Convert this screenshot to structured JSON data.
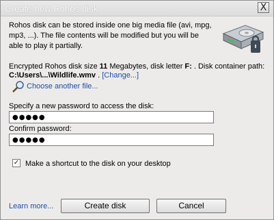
{
  "window": {
    "title": "Create new Rohos disk",
    "close_glyph": "X"
  },
  "intro": {
    "text": "Rohos disk can be stored inside one big media file (avi, mpg, mp3, ...). The file contents will be modified but you will be able to play it partially."
  },
  "icons": {
    "disk": "disk-icon",
    "choose": "magnifier-icon",
    "check": "checkmark-icon"
  },
  "info": {
    "size_prefix": "Encrypted Rohos disk size ",
    "size_value": "11",
    "size_unit": " Megabytes, disk letter ",
    "disk_letter": "F:",
    "container_suffix": " .  Disk container path:",
    "path": "C:\\Users\\...\\Wildlife.wmv",
    "change_link": "[Change...]"
  },
  "choose_file": {
    "label": "Choose another file..."
  },
  "password": {
    "label": "Specify a new password to access the disk:",
    "value": "●●●●●"
  },
  "confirm": {
    "label": "Confirm password:",
    "value": "●●●●●"
  },
  "shortcut": {
    "checked": true,
    "check_glyph": "✓",
    "label": "Make a shortcut to the disk on your desktop"
  },
  "footer": {
    "learn_more": "Learn more...",
    "create_button": "Create disk",
    "cancel_button": "Cancel"
  }
}
